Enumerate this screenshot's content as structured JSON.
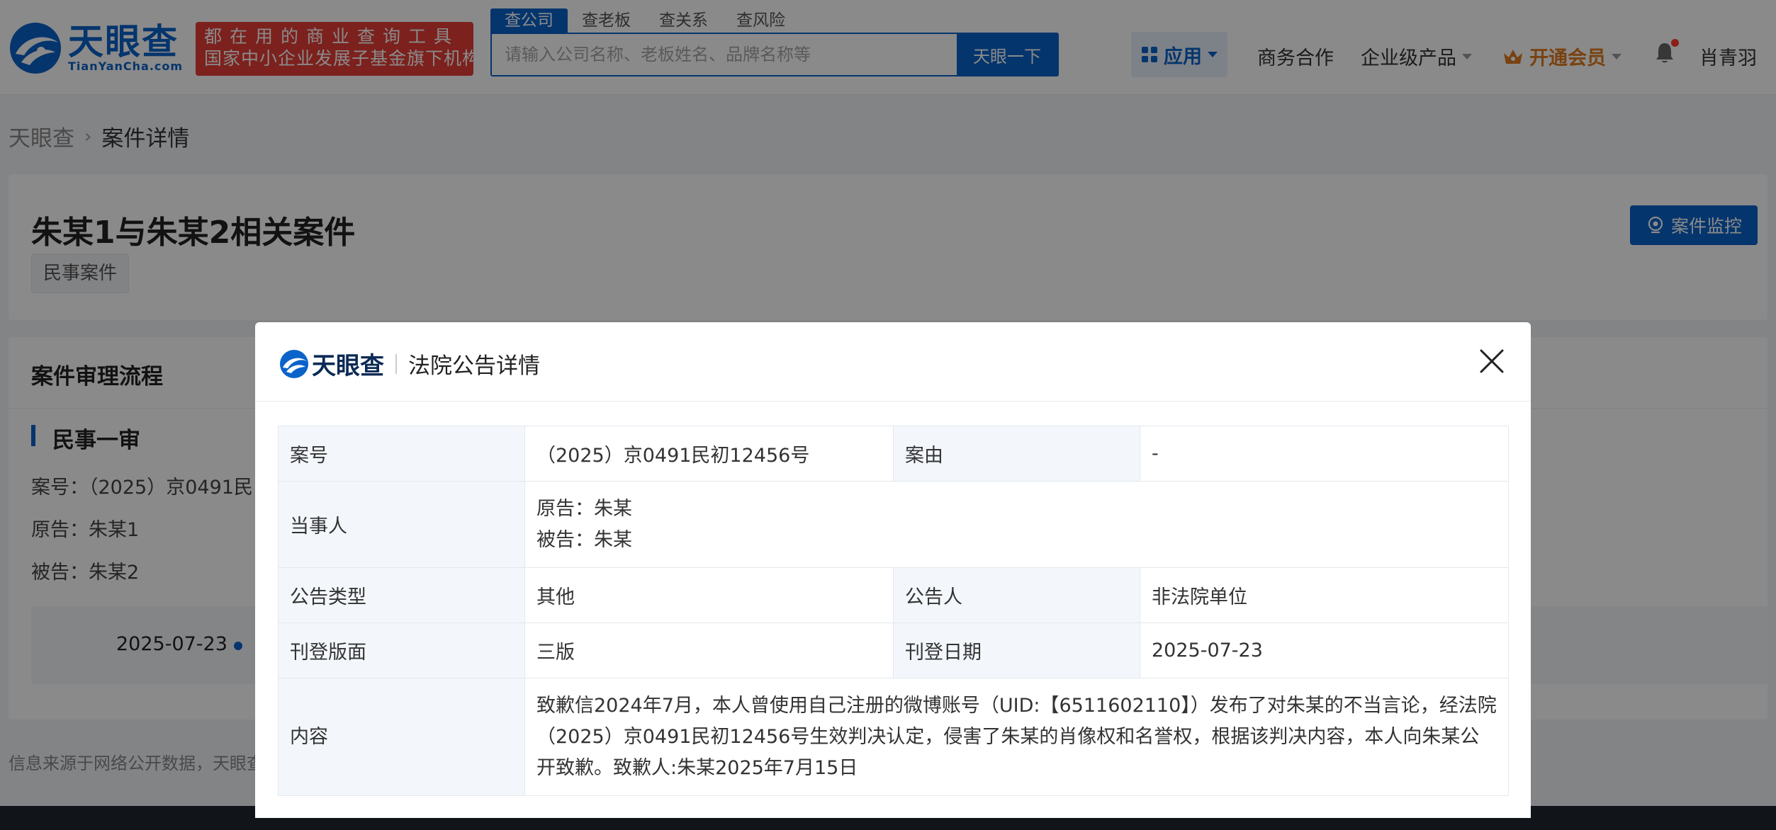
{
  "header": {
    "logo_cn": "天眼查",
    "logo_en": "TianYanCha.com",
    "slogan_line1": "都在用的商业查询工具",
    "slogan_line2": "国家中小企业发展子基金旗下机构",
    "search_tabs": [
      {
        "label": "查公司",
        "active": true
      },
      {
        "label": "查老板",
        "active": false
      },
      {
        "label": "查关系",
        "active": false
      },
      {
        "label": "查风险",
        "active": false
      }
    ],
    "search_placeholder": "请输入公司名称、老板姓名、品牌名称等",
    "search_button": "天眼一下",
    "nav": {
      "apps": "应用",
      "business": "商务合作",
      "enterprise": "企业级产品",
      "vip": "开通会员",
      "user": "肖青羽"
    },
    "colors": {
      "brand": "#0b63c9",
      "slogan_bg": "#e53e36",
      "vip": "#e07a1f"
    }
  },
  "breadcrumb": {
    "home": "天眼查",
    "current": "案件详情"
  },
  "case": {
    "title": "朱某1与朱某2相关案件",
    "tag": "民事案件",
    "monitor_button": "案件监控"
  },
  "flow": {
    "title": "案件审理流程",
    "stage": "民事一审",
    "case_no": "案号：（2025）京0491民",
    "plaintiff": "原告：朱某1",
    "defendant": "被告：朱某2",
    "timeline_date": "2025-07-23"
  },
  "footer_note": "信息来源于网络公开数据，天眼查",
  "modal": {
    "logo_text": "天眼查",
    "title": "法院公告详情",
    "rows": {
      "case_no_label": "案号",
      "case_no_value": "（2025）京0491民初12456号",
      "cause_label": "案由",
      "cause_value": "-",
      "parties_label": "当事人",
      "plaintiff_value": "原告：朱某",
      "defendant_value": "被告：朱某",
      "type_label": "公告类型",
      "type_value": "其他",
      "announcer_label": "公告人",
      "announcer_value": "非法院单位",
      "page_label": "刊登版面",
      "page_value": "三版",
      "date_label": "刊登日期",
      "date_value": "2025-07-23",
      "content_label": "内容",
      "content_value": "致歉信2024年7月，本人曾使用自己注册的微博账号（UID:【6511602110】）发布了对朱某的不当言论，经法院（2025）京0491民初12456号生效判决认定，侵害了朱某的肖像权和名誉权，根据该判决内容，本人向朱某公开致歉。致歉人:朱某2025年7月15日"
    }
  }
}
